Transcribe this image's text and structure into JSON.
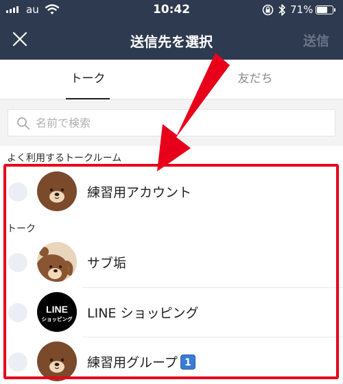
{
  "status_bar": {
    "carrier": "au",
    "time": "10:42",
    "battery": "71%",
    "battery_level": 0.71
  },
  "header": {
    "title": "送信先を選択",
    "send_label": "送信",
    "close_icon": "close-icon"
  },
  "tabs": [
    {
      "label": "トーク",
      "selected": true
    },
    {
      "label": "友だち",
      "selected": false
    }
  ],
  "search": {
    "placeholder": "名前で検索",
    "value": ""
  },
  "sections": {
    "frequent_label": "よく利用するトークルーム",
    "talk_label": "トーク"
  },
  "frequent": [
    {
      "name": "練習用アカウント",
      "avatar": "brown-bear-avatar"
    }
  ],
  "talks": [
    {
      "name": "サブ垢",
      "avatar": "brown-bear-peeking-avatar"
    },
    {
      "name": "LINE ショッピング",
      "avatar": "line-shopping-logo",
      "logo_line1": "LINE",
      "logo_line2": "ショッピング"
    },
    {
      "name": "練習用グループ",
      "badge": "1",
      "avatar": "brown-bear-avatar"
    }
  ],
  "colors": {
    "header_bg": "#2e3a4f",
    "annotation": "#e8001a",
    "radio": "#ebeef5"
  }
}
